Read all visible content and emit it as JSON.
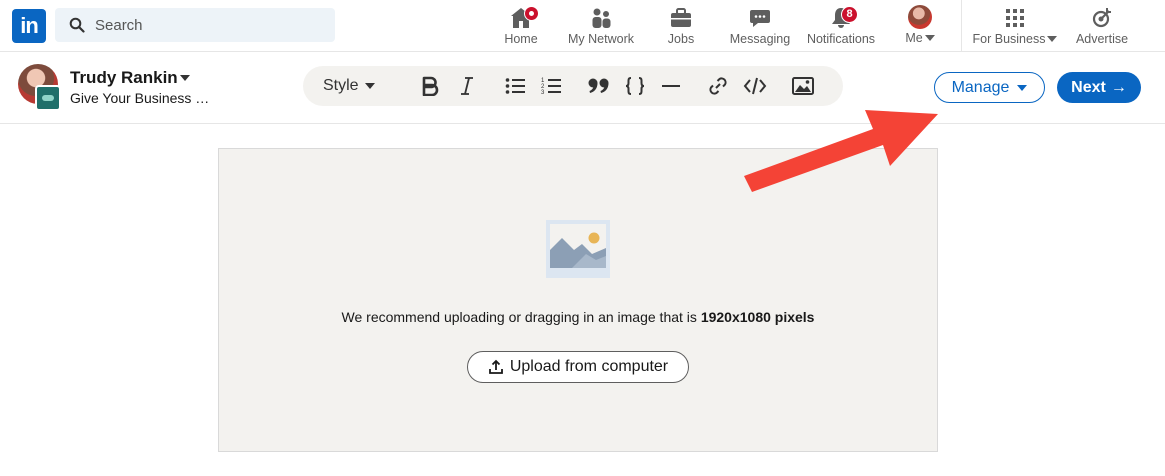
{
  "nav": {
    "logo": "in",
    "search_placeholder": "Search",
    "items": [
      {
        "label": "Home",
        "icon": "home-icon"
      },
      {
        "label": "My Network",
        "icon": "network-icon"
      },
      {
        "label": "Jobs",
        "icon": "briefcase-icon"
      },
      {
        "label": "Messaging",
        "icon": "messaging-icon"
      },
      {
        "label": "Notifications",
        "icon": "bell-icon",
        "badge": "8"
      },
      {
        "label": "Me",
        "icon": "avatar"
      },
      {
        "label": "For Business",
        "icon": "grid-icon"
      },
      {
        "label": "Advertise",
        "icon": "advertise-icon"
      }
    ]
  },
  "editor": {
    "author_name": "Trudy Rankin",
    "author_sub": "Give Your Business …",
    "toolbar": {
      "style_label": "Style",
      "tools": [
        "bold-icon",
        "italic-icon",
        "bullet-list-icon",
        "numbered-list-icon",
        "quote-icon",
        "code-block-icon",
        "divider-icon",
        "link-icon",
        "embed-icon",
        "image-icon"
      ]
    },
    "manage_label": "Manage",
    "next_label": "Next",
    "next_arrow": "→"
  },
  "upload": {
    "recommend_text": "We recommend uploading or dragging in an image that is ",
    "recommend_bold": "1920x1080 pixels",
    "upload_label": "Upload from computer"
  },
  "colors": {
    "brand_blue": "#0a66c2",
    "annotation_red": "#f44336",
    "badge_red": "#cb112d",
    "canvas_bg": "#f3f2ef"
  }
}
